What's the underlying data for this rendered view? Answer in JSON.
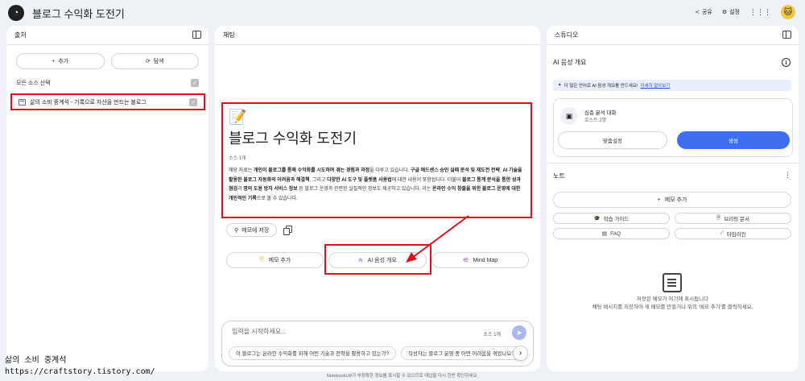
{
  "app": {
    "title": "블로그 수익화 도전기"
  },
  "topbar": {
    "share_label": "공유",
    "settings_label": "설정"
  },
  "source_panel": {
    "title": "출처",
    "add_label": "추가",
    "discover_label": "탐색",
    "select_all_label": "모든 소스 선택",
    "items": [
      {
        "label": "삶의 소비 중계석 - 기록으로 자산을 만드는 블로그"
      }
    ]
  },
  "chat_panel": {
    "title": "채팅",
    "summary": {
      "emoji": "📝",
      "title": "블로그 수익화 도전기",
      "source_count": "소스 1개"
    },
    "save_memo_label": "메모에 저장",
    "actions": [
      {
        "label": "메모 추가"
      },
      {
        "label": "AI 음성 개요"
      },
      {
        "label": "Mind Map"
      }
    ],
    "input": {
      "placeholder": "입력을 시작하세요...",
      "source_count": "소스 1개",
      "suggestions": [
        "이 블로그는 온라인 수익화를 위해 어떤 기술과 전략을 활용하고 있는가?",
        "작성자는 블로그 운영 중 어떤 어려움을 겪었나요?"
      ]
    }
  },
  "studio_panel": {
    "title": "스튜디오",
    "audio_title": "AI 음성 개요",
    "lang_banner": "더 많은 언어로 AI 음성 개요를 만드세요!",
    "lang_link": "자세히 알아보기",
    "convo_title": "심층 분석 대화",
    "convo_sub": "호스트 2명",
    "customize_label": "맞춤설정",
    "generate_label": "생성",
    "notes_title": "노트",
    "add_note_label": "메모 추가",
    "note_buttons": [
      {
        "icon": "🎓",
        "label": "학습 가이드"
      },
      {
        "icon": "🗎",
        "label": "브리핑 문서"
      },
      {
        "icon": "▤",
        "label": "FAQ"
      },
      {
        "icon": "⟋",
        "label": "타임라인"
      }
    ],
    "empty_line1": "저장된 메모가 여기에 표시됩니다",
    "empty_line2": "채팅 메시지를 저장하여 새 메모를 만들거나 위의 '메모 추가'를 클릭하세요."
  },
  "footer": {
    "disclaimer": "NotebookLM가 부정확한 정보를 표시할 수 있으므로 대답을 다시 한번 확인하세요."
  },
  "watermark": {
    "line1": "삶의 소비 중계석",
    "line2": "https://craftstory.tistory.com/"
  },
  "colors": {
    "accent": "#3d6ef0",
    "highlight": "#e0101b"
  }
}
